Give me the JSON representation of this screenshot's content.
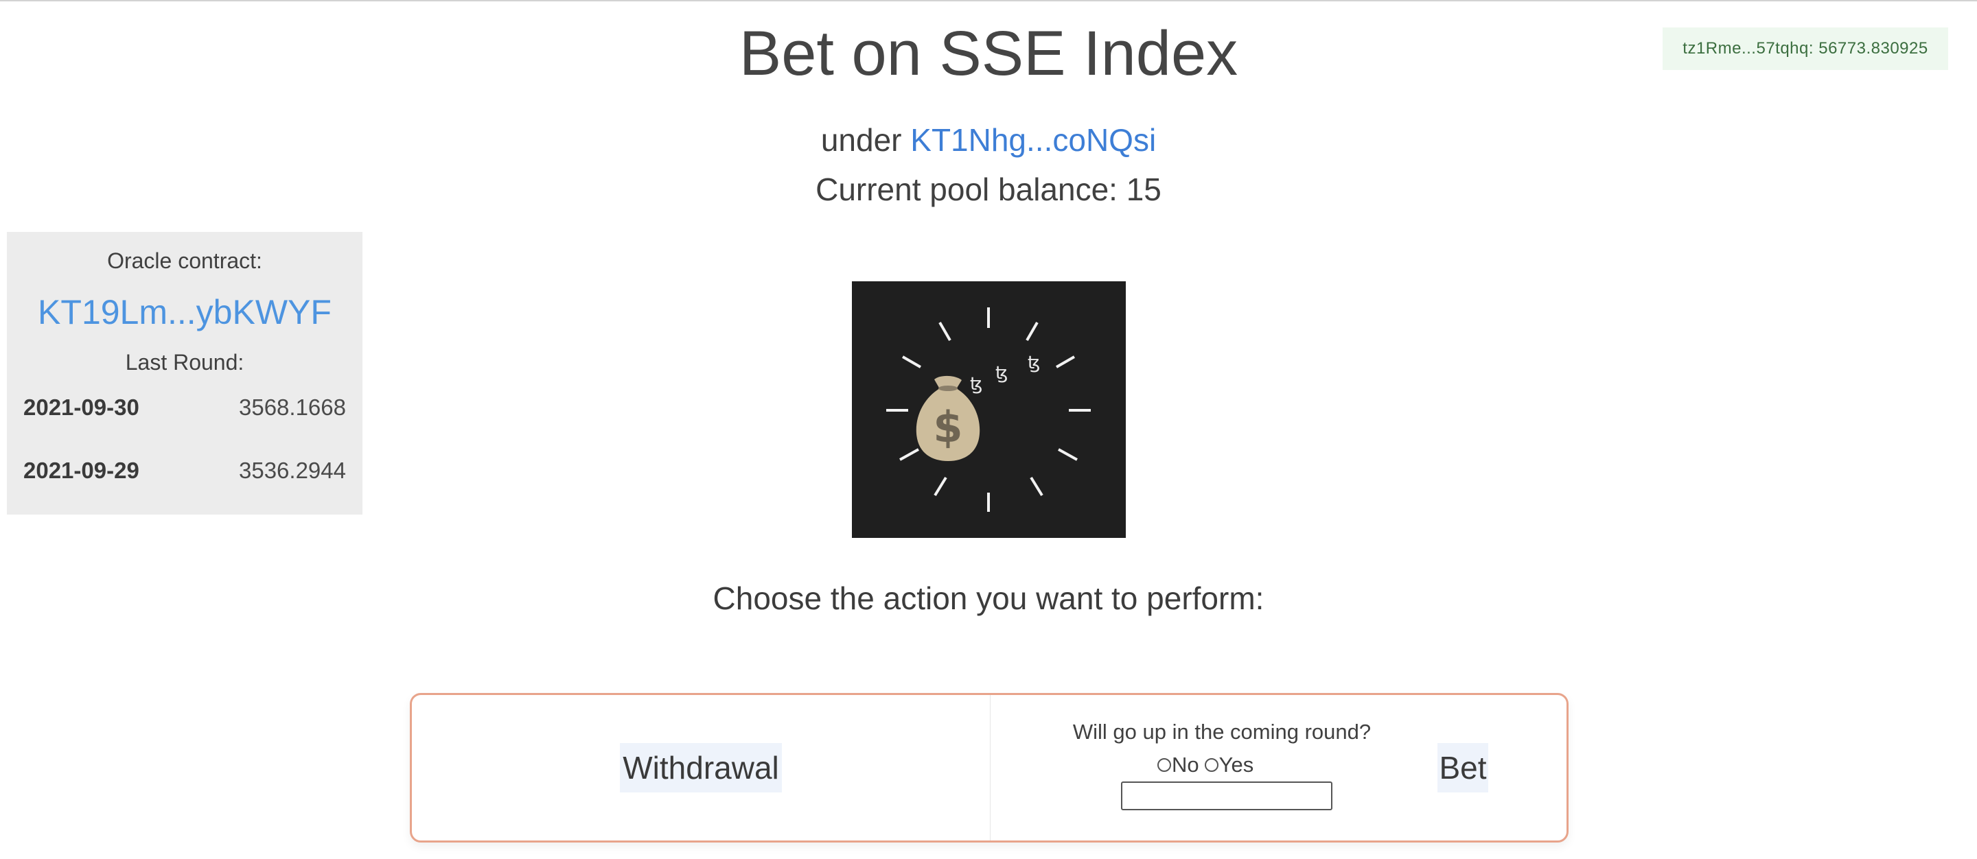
{
  "header": {
    "title": "Bet on SSE Index",
    "under_prefix": "under",
    "contract_link": "KT1Nhg...coNQsi",
    "pool_balance_text": "Current pool balance: 15"
  },
  "wallet": {
    "badge_text": "tz1Rme...57tqhq: 56773.830925"
  },
  "oracle": {
    "label": "Oracle contract:",
    "contract_link": "KT19Lm...ybKWYF",
    "last_round_label": "Last Round:",
    "rounds": [
      {
        "date": "2021-09-30",
        "value": "3568.1668"
      },
      {
        "date": "2021-09-29",
        "value": "3536.2944"
      }
    ]
  },
  "hero": {
    "icon": "money-bag-icon",
    "coin_glyph": "ꜩ"
  },
  "actions": {
    "prompt": "Choose the action you want to perform:",
    "withdraw_label": "Withdrawal",
    "bet_question": "Will go up in the coming round?",
    "option_no": "No",
    "option_yes": "Yes",
    "amount_value": "",
    "bet_label": "Bet"
  },
  "colors": {
    "link": "#3d7ed6",
    "oracle_link": "#4d94e0",
    "card_border": "#e8a48b",
    "wallet_badge_bg": "#eef8ef",
    "wallet_badge_text": "#3b6e3f",
    "button_bg": "#eef3fb"
  }
}
